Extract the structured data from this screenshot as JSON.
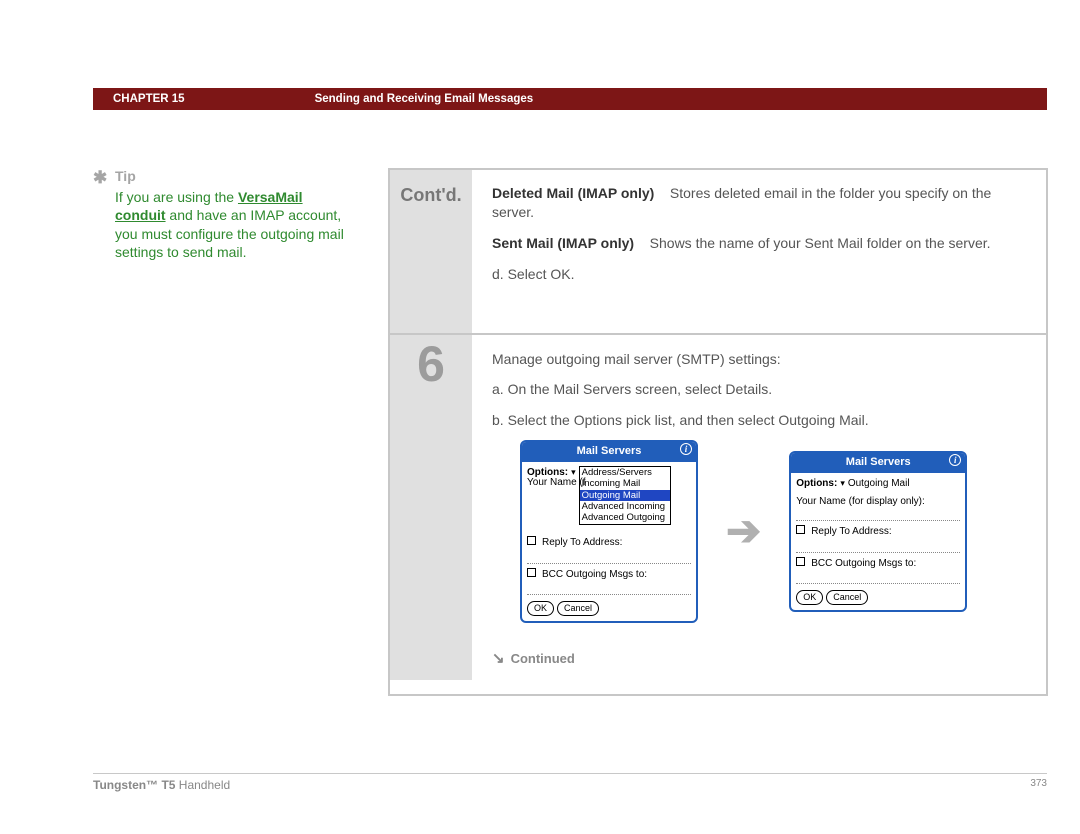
{
  "header": {
    "chapter": "CHAPTER 15",
    "title": "Sending and Receiving Email Messages"
  },
  "tip": {
    "label": "Tip",
    "text_before_link": "If you are using the ",
    "link": "VersaMail conduit",
    "text_after_link": " and have an IMAP account, you must configure the outgoing mail settings to send mail."
  },
  "contd": {
    "label": "Cont'd.",
    "def1_term": "Deleted Mail (IMAP only)",
    "def1_text": "Stores deleted email in the folder you specify on the server.",
    "def2_term": "Sent Mail (IMAP only)",
    "def2_text": "Shows the name of your Sent Mail folder on the server.",
    "step_d": "d.  Select OK."
  },
  "step6": {
    "num": "6",
    "line1": "Manage outgoing mail server (SMTP) settings:",
    "line_a": "a.  On the Mail Servers screen, select Details.",
    "line_b": "b.  Select the Options pick list, and then select Outgoing Mail."
  },
  "screen1": {
    "title": "Mail Servers",
    "options_label": "Options:",
    "name_label": "Your Name (f",
    "dd0": "Address/Servers",
    "dd1": "Incoming Mail",
    "dd2": "Outgoing Mail",
    "dd3": "Advanced Incoming",
    "dd4": "Advanced Outgoing",
    "reply": "Reply To Address:",
    "bcc": "BCC Outgoing Msgs to:",
    "ok": "OK",
    "cancel": "Cancel"
  },
  "screen2": {
    "title": "Mail Servers",
    "options_label": "Options:",
    "options_val": "Outgoing Mail",
    "name_label": "Your Name (for display only):",
    "reply": "Reply To Address:",
    "bcc": "BCC Outgoing Msgs to:",
    "ok": "OK",
    "cancel": "Cancel"
  },
  "continued": "Continued",
  "footer": {
    "product_bold": "Tungsten™ T5",
    "product_rest": " Handheld",
    "page": "373"
  }
}
